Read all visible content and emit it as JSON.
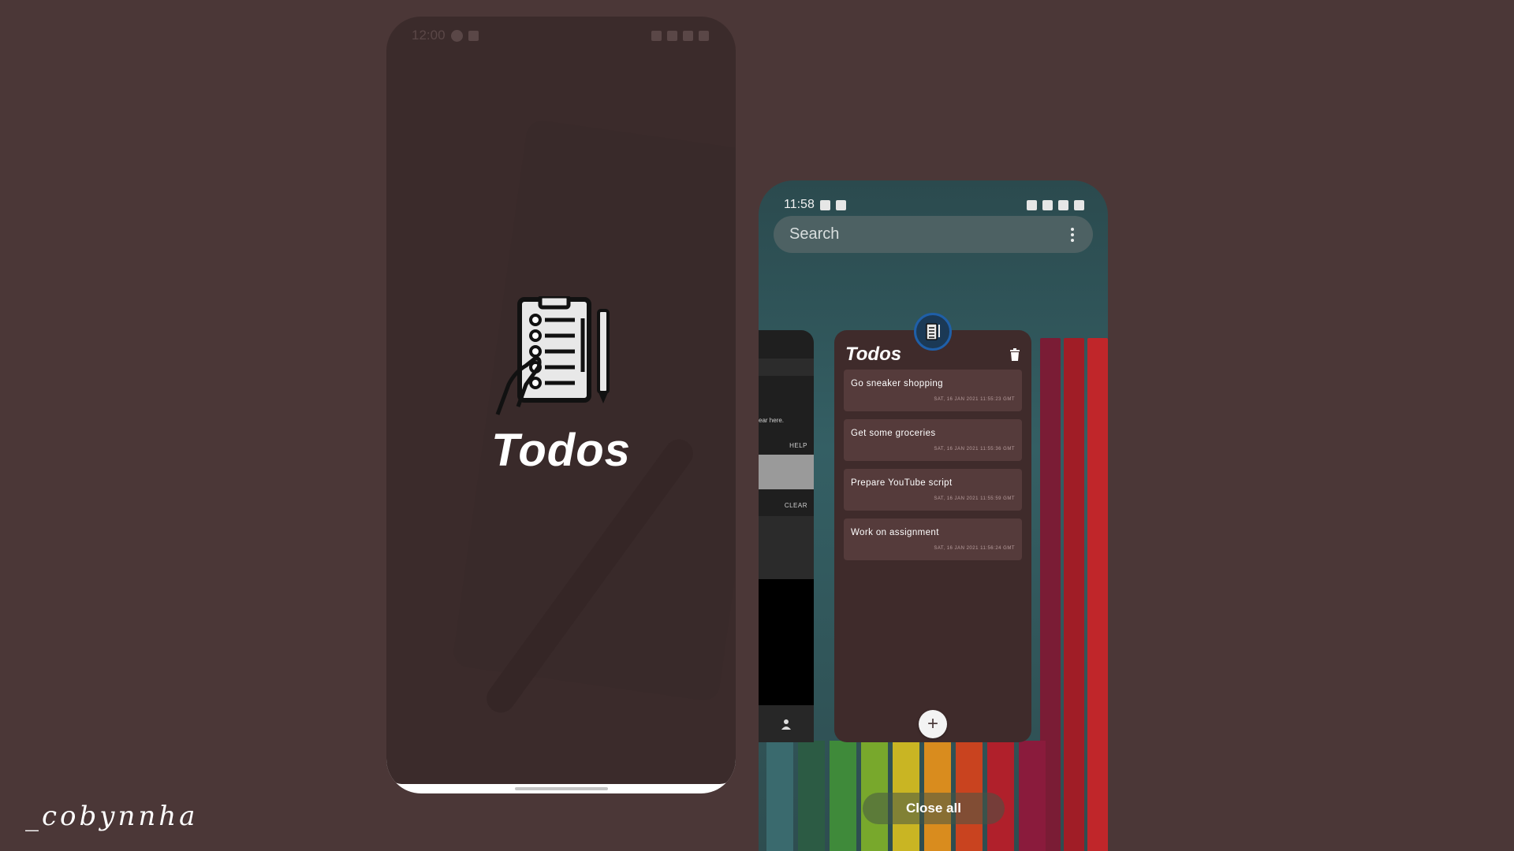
{
  "left_phone": {
    "status_time": "12:00",
    "splash_title": "Todos"
  },
  "right_phone": {
    "status_time": "11:58",
    "search": {
      "placeholder": "Search"
    },
    "side_card": {
      "hint_text": "ear here.",
      "help_label": "HELP",
      "clear_label": "CLEAR"
    },
    "todo_card": {
      "title": "Todos",
      "items": [
        {
          "text": "Go sneaker shopping",
          "date": "SAT, 16 JAN 2021 11:55:23 GMT"
        },
        {
          "text": "Get some groceries",
          "date": "SAT, 16 JAN 2021 11:55:36 GMT"
        },
        {
          "text": "Prepare YouTube script",
          "date": "SAT, 16 JAN 2021 11:55:59 GMT"
        },
        {
          "text": "Work on assignment",
          "date": "SAT, 16 JAN 2021 11:56:24 GMT"
        }
      ],
      "add_icon": "plus-icon",
      "delete_icon": "trash-icon"
    },
    "close_all_label": "Close all"
  },
  "watermark": "_cobynnha",
  "colors": {
    "background": "#4b3737",
    "card": "#3f2b2b",
    "todo_item": "#553b3b",
    "app_badge_border": "#1f5fa8"
  }
}
